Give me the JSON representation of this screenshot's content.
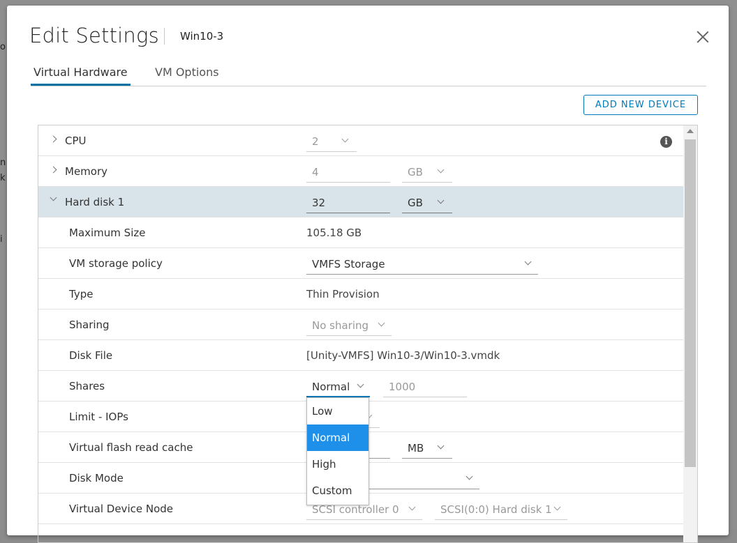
{
  "dialog": {
    "title": "Edit Settings",
    "vm_name": "Win10-3",
    "close_icon": "close-icon"
  },
  "tabs": [
    {
      "label": "Virtual Hardware",
      "active": true
    },
    {
      "label": "VM Options",
      "active": false
    }
  ],
  "toolbar": {
    "add_device_label": "ADD NEW DEVICE"
  },
  "hardware": {
    "cpu": {
      "label": "CPU",
      "value": "2"
    },
    "memory": {
      "label": "Memory",
      "value": "4",
      "unit": "GB"
    },
    "hard_disk": {
      "label": "Hard disk 1",
      "value": "32",
      "unit": "GB"
    },
    "max_size": {
      "label": "Maximum Size",
      "value": "105.18 GB"
    },
    "storage_policy": {
      "label": "VM storage policy",
      "value": "VMFS Storage"
    },
    "type": {
      "label": "Type",
      "value": "Thin Provision"
    },
    "sharing": {
      "label": "Sharing",
      "value": "No sharing"
    },
    "disk_file": {
      "label": "Disk File",
      "value": "[Unity-VMFS] Win10-3/Win10-3.vmdk"
    },
    "shares": {
      "label": "Shares",
      "value": "Normal",
      "number_placeholder": "1000"
    },
    "limit_iops": {
      "label": "Limit - IOPs"
    },
    "flash_cache": {
      "label": "Virtual flash read cache",
      "unit": "MB"
    },
    "disk_mode": {
      "label": "Disk Mode"
    },
    "device_node": {
      "label": "Virtual Device Node",
      "controller": "SCSI controller 0",
      "node": "SCSI(0:0) Hard disk 1"
    }
  },
  "shares_menu": {
    "options": [
      "Low",
      "Normal",
      "High",
      "Custom"
    ],
    "highlighted": "Normal"
  },
  "colors": {
    "accent": "#0079b8",
    "selected_row": "#d9e4ea",
    "menu_highlight": "#1e90ea"
  }
}
